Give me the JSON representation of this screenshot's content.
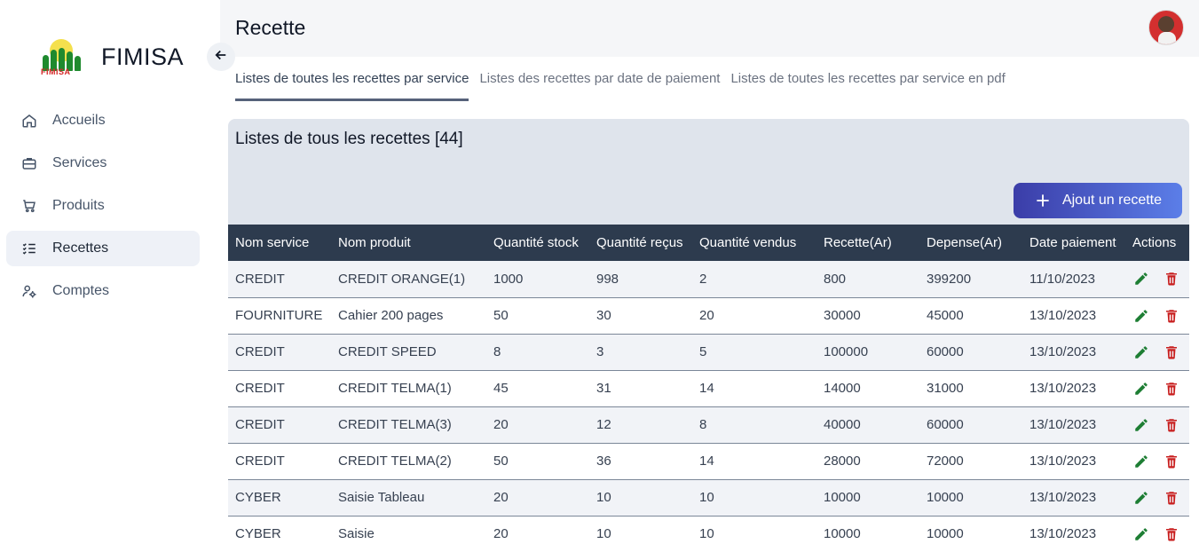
{
  "brand": {
    "name": "FIMISA",
    "logo_text": "FIMISA"
  },
  "sidebar": {
    "items": [
      {
        "label": "Accueils",
        "icon": "home-icon"
      },
      {
        "label": "Services",
        "icon": "briefcase-icon"
      },
      {
        "label": "Produits",
        "icon": "cart-icon"
      },
      {
        "label": "Recettes",
        "icon": "list-check-icon",
        "active": true
      },
      {
        "label": "Comptes",
        "icon": "user-cog-icon"
      }
    ]
  },
  "header": {
    "title": "Recette"
  },
  "tabs": [
    {
      "label": "Listes de toutes les recettes par service",
      "active": true
    },
    {
      "label": "Listes des recettes par date de paiement"
    },
    {
      "label": "Listes de toutes les recettes par service en pdf"
    }
  ],
  "card": {
    "title": "Listes de tous les recettes [44]",
    "add_button": "Ajout un recette"
  },
  "table": {
    "columns": [
      "Nom service",
      "Nom produit",
      "Quantité stock",
      "Quantité reçus",
      "Quantité vendus",
      "Recette(Ar)",
      "Depense(Ar)",
      "Date paiement",
      "Actions"
    ],
    "rows": [
      [
        "CREDIT",
        "CREDIT ORANGE(1)",
        "1000",
        "998",
        "2",
        "800",
        "399200",
        "11/10/2023"
      ],
      [
        "FOURNITURE",
        "Cahier 200 pages",
        "50",
        "30",
        "20",
        "30000",
        "45000",
        "13/10/2023"
      ],
      [
        "CREDIT",
        "CREDIT SPEED",
        "8",
        "3",
        "5",
        "100000",
        "60000",
        "13/10/2023"
      ],
      [
        "CREDIT",
        "CREDIT TELMA(1)",
        "45",
        "31",
        "14",
        "14000",
        "31000",
        "13/10/2023"
      ],
      [
        "CREDIT",
        "CREDIT TELMA(3)",
        "20",
        "12",
        "8",
        "40000",
        "60000",
        "13/10/2023"
      ],
      [
        "CREDIT",
        "CREDIT TELMA(2)",
        "50",
        "36",
        "14",
        "28000",
        "72000",
        "13/10/2023"
      ],
      [
        "CYBER",
        "Saisie Tableau",
        "20",
        "10",
        "10",
        "10000",
        "10000",
        "13/10/2023"
      ],
      [
        "CYBER",
        "Saisie",
        "20",
        "10",
        "10",
        "10000",
        "10000",
        "13/10/2023"
      ]
    ]
  },
  "colors": {
    "edit": "#1e7e34",
    "delete": "#c81e1e",
    "header_row": "#2d3b4e",
    "button_start": "#3b3da8",
    "button_end": "#5b7ee8"
  }
}
